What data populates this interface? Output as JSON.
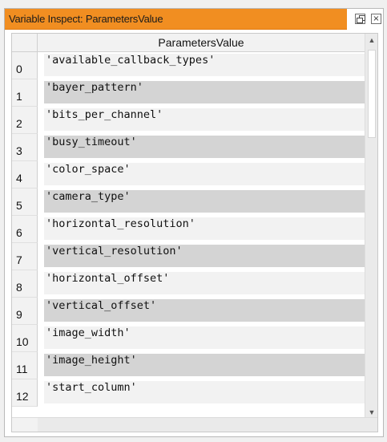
{
  "window": {
    "title": "Variable Inspect: ParametersValue",
    "float_icon": "restore-icon",
    "close_symbol": "×"
  },
  "table": {
    "column_header": "ParametersValue",
    "rows": [
      {
        "index": "0",
        "value": "'available_callback_types'"
      },
      {
        "index": "1",
        "value": "'bayer_pattern'"
      },
      {
        "index": "2",
        "value": "'bits_per_channel'"
      },
      {
        "index": "3",
        "value": "'busy_timeout'"
      },
      {
        "index": "4",
        "value": "'color_space'"
      },
      {
        "index": "5",
        "value": "'camera_type'"
      },
      {
        "index": "6",
        "value": "'horizontal_resolution'"
      },
      {
        "index": "7",
        "value": "'vertical_resolution'"
      },
      {
        "index": "8",
        "value": "'horizontal_offset'"
      },
      {
        "index": "9",
        "value": "'vertical_offset'"
      },
      {
        "index": "10",
        "value": "'image_width'"
      },
      {
        "index": "11",
        "value": "'image_height'"
      },
      {
        "index": "12",
        "value": "'start_column'"
      }
    ]
  },
  "scrollbar": {
    "up": "▲",
    "down": "▼"
  },
  "colors": {
    "title_accent": "#f18e21",
    "row_shade": "#d4d4d4"
  }
}
